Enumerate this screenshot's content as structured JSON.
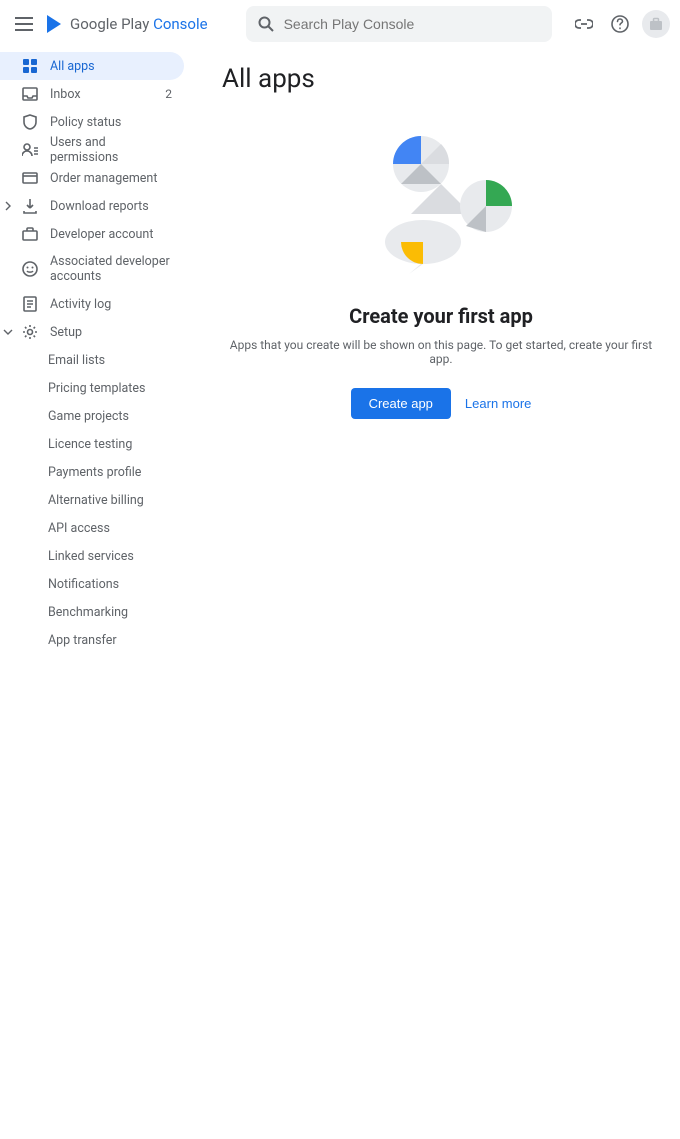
{
  "header": {
    "logo_text_1": "Google Play",
    "logo_text_2": "Console",
    "search_placeholder": "Search Play Console"
  },
  "sidebar": {
    "items": [
      {
        "label": "All apps",
        "icon": "apps-grid-icon",
        "active": true
      },
      {
        "label": "Inbox",
        "icon": "inbox-icon",
        "badge": "2"
      },
      {
        "label": "Policy status",
        "icon": "shield-icon"
      },
      {
        "label": "Users and permissions",
        "icon": "users-icon"
      },
      {
        "label": "Order management",
        "icon": "card-icon"
      },
      {
        "label": "Download reports",
        "icon": "download-icon",
        "expandable": true
      },
      {
        "label": "Developer account",
        "icon": "briefcase-icon"
      },
      {
        "label": "Associated developer accounts",
        "icon": "face-icon"
      },
      {
        "label": "Activity log",
        "icon": "log-icon"
      },
      {
        "label": "Setup",
        "icon": "gear-icon",
        "expanded": true
      }
    ],
    "setup_children": [
      {
        "label": "Email lists"
      },
      {
        "label": "Pricing templates"
      },
      {
        "label": "Game projects"
      },
      {
        "label": "Licence testing"
      },
      {
        "label": "Payments profile"
      },
      {
        "label": "Alternative billing"
      },
      {
        "label": "API access"
      },
      {
        "label": "Linked services"
      },
      {
        "label": "Notifications"
      },
      {
        "label": "Benchmarking"
      },
      {
        "label": "App transfer"
      }
    ]
  },
  "main": {
    "title": "All apps",
    "empty_title": "Create your first app",
    "empty_desc": "Apps that you create will be shown on this page. To get started, create your first app.",
    "create_btn": "Create app",
    "learn_more": "Learn more"
  }
}
